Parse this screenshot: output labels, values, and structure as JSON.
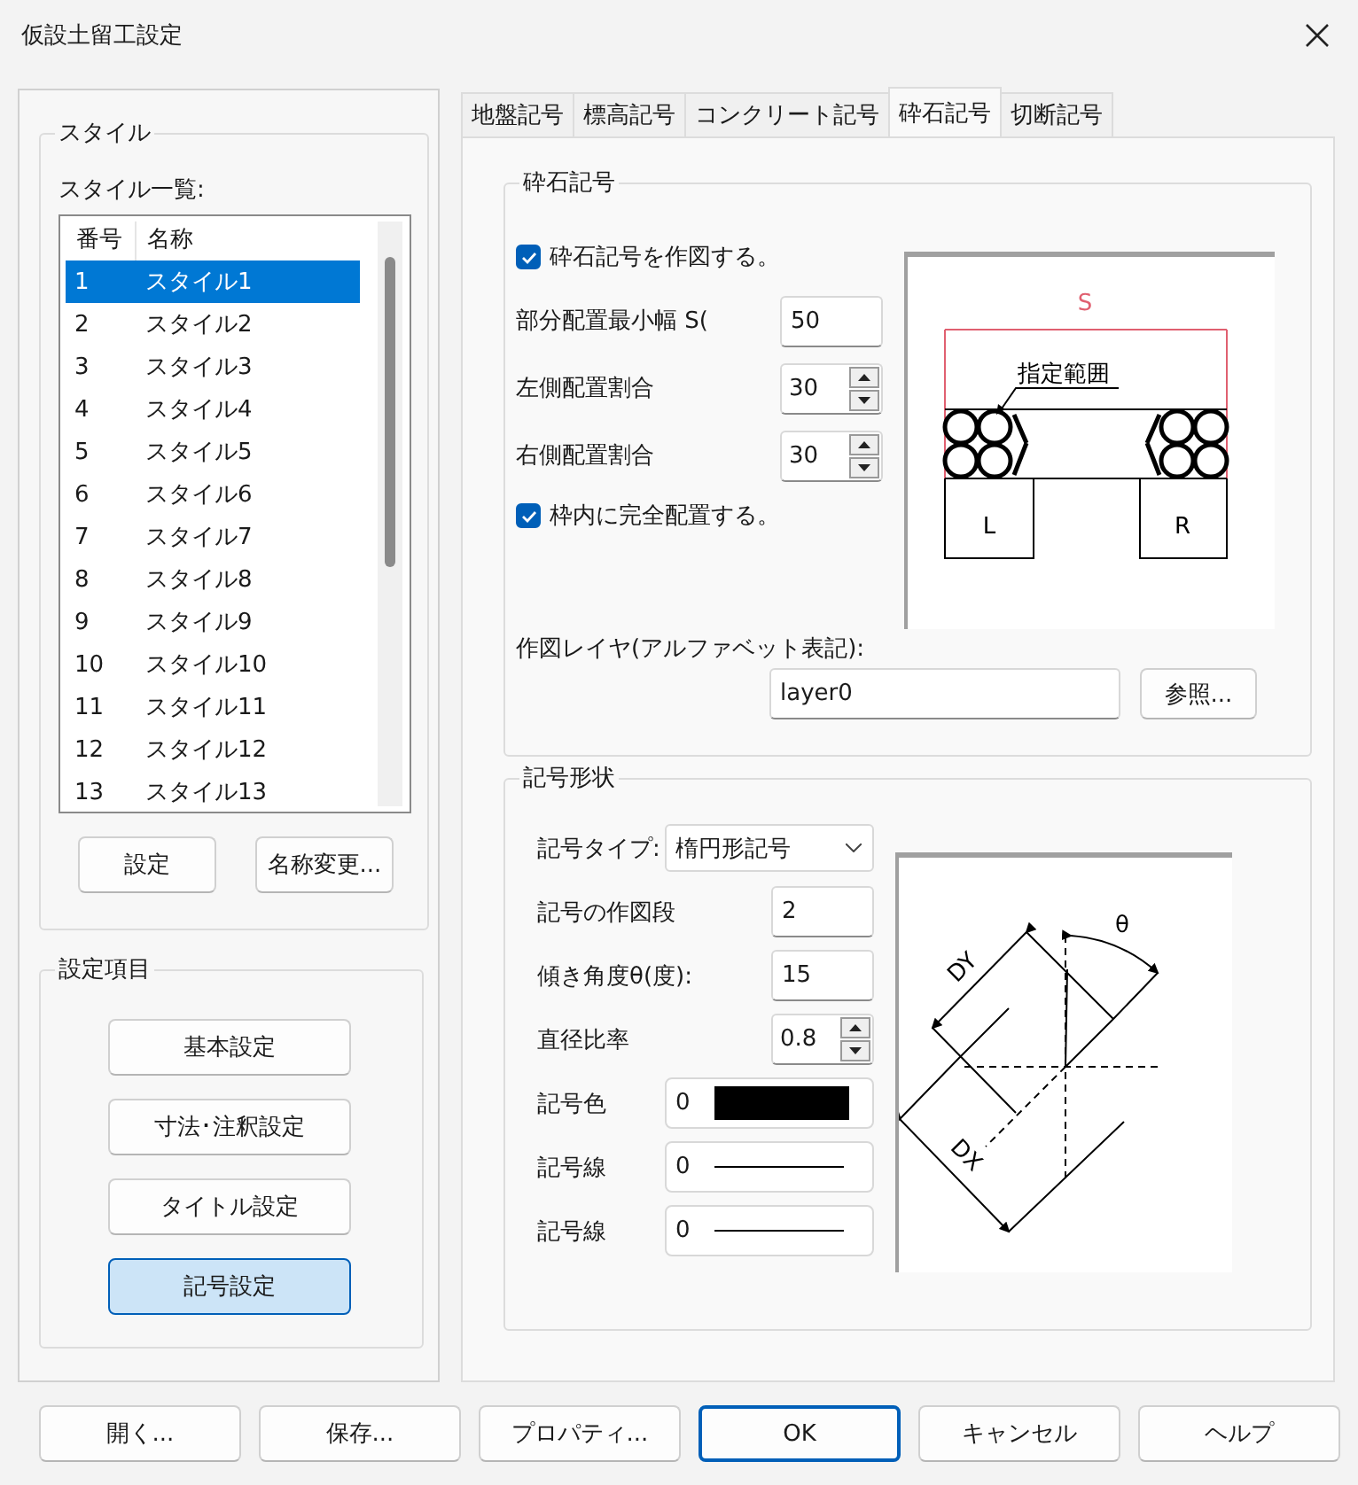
{
  "window": {
    "title": "仮設土留工設定"
  },
  "style_group": {
    "title": "スタイル",
    "list_label": "スタイル一覧:",
    "columns": [
      "番号",
      "名称"
    ],
    "rows": [
      {
        "number": "1",
        "name": "スタイル1",
        "selected": true
      },
      {
        "number": "2",
        "name": "スタイル2",
        "selected": false
      },
      {
        "number": "3",
        "name": "スタイル3",
        "selected": false
      },
      {
        "number": "4",
        "name": "スタイル4",
        "selected": false
      },
      {
        "number": "5",
        "name": "スタイル5",
        "selected": false
      },
      {
        "number": "6",
        "name": "スタイル6",
        "selected": false
      },
      {
        "number": "7",
        "name": "スタイル7",
        "selected": false
      },
      {
        "number": "8",
        "name": "スタイル8",
        "selected": false
      },
      {
        "number": "9",
        "name": "スタイル9",
        "selected": false
      },
      {
        "number": "10",
        "name": "スタイル10",
        "selected": false
      },
      {
        "number": "11",
        "name": "スタイル11",
        "selected": false
      },
      {
        "number": "12",
        "name": "スタイル12",
        "selected": false
      },
      {
        "number": "13",
        "name": "スタイル13",
        "selected": false
      }
    ],
    "buttons": [
      "設定",
      "名称変更..."
    ]
  },
  "settings_group": {
    "title": "設定項目",
    "buttons": [
      {
        "label": "基本設定",
        "selected": false
      },
      {
        "label": "寸法･注釈設定",
        "selected": false
      },
      {
        "label": "タイトル設定",
        "selected": false
      },
      {
        "label": "記号設定",
        "selected": true
      }
    ]
  },
  "tabs": [
    {
      "label": "地盤記号",
      "selected": false
    },
    {
      "label": "標高記号",
      "selected": false
    },
    {
      "label": "コンクリート記号",
      "selected": false
    },
    {
      "label": "砕石記号",
      "selected": true
    },
    {
      "label": "切断記号",
      "selected": false
    }
  ],
  "gravel_group": {
    "title": "砕石記号",
    "draw_checkbox": {
      "label": "砕石記号を作図する。",
      "checked": true
    },
    "fields": [
      {
        "kind": "text",
        "label": "部分配置最小幅 S(",
        "value": "50"
      },
      {
        "kind": "spin",
        "label": "左側配置割合",
        "value": "30"
      },
      {
        "kind": "spin",
        "label": "右側配置割合",
        "value": "30"
      }
    ],
    "fit_checkbox": {
      "label": "枠内に完全配置する。",
      "checked": true
    },
    "preview_labels": {
      "span": "S",
      "range": "指定範囲",
      "left": "L",
      "right": "R"
    },
    "layer_label": "作図レイヤ(アルファベット表記):",
    "layer_value": "layer0",
    "browse_button": "参照..."
  },
  "shape_group": {
    "title": "記号形状",
    "rows": [
      {
        "kind": "select",
        "label": "記号タイプ:",
        "value": "楕円形記号"
      },
      {
        "kind": "text",
        "label": "記号の作図段",
        "value": "2"
      },
      {
        "kind": "text",
        "label": "傾き角度θ(度):",
        "value": "15"
      },
      {
        "kind": "spin",
        "label": "直径比率",
        "value": "0.8"
      },
      {
        "kind": "color",
        "label": "記号色",
        "value": "0",
        "color": "#000000"
      },
      {
        "kind": "line",
        "label": "記号線",
        "value": "0"
      },
      {
        "kind": "line",
        "label": "記号線",
        "value": "0"
      }
    ],
    "preview_labels": {
      "theta": "θ",
      "dy": "DY",
      "dx": "DX"
    }
  },
  "buttons": [
    {
      "label": "開く...",
      "default": false
    },
    {
      "label": "保存...",
      "default": false
    },
    {
      "label": "プロパティ...",
      "default": false
    },
    {
      "label": "OK",
      "default": true
    },
    {
      "label": "キャンセル",
      "default": false
    },
    {
      "label": "ヘルプ",
      "default": false
    }
  ]
}
